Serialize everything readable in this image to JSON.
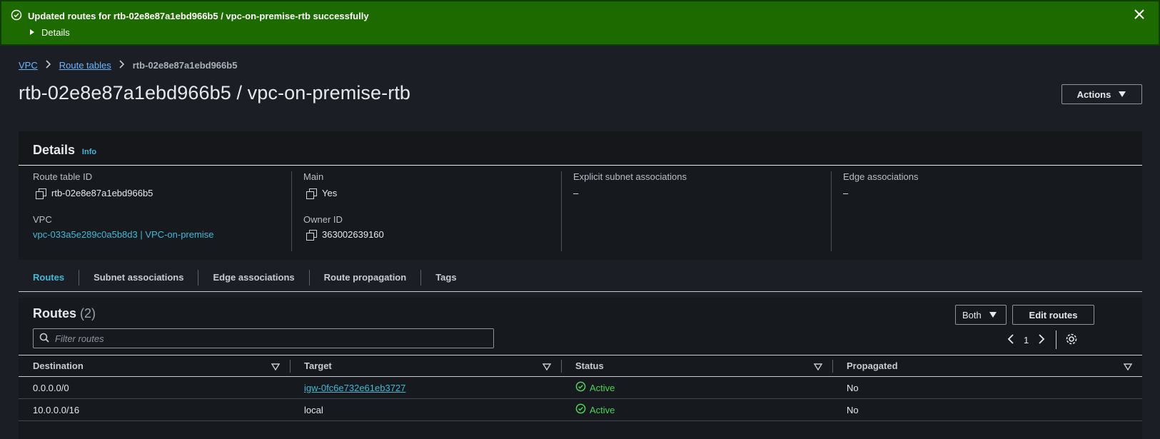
{
  "flash": {
    "message": "Updated routes for rtb-02e8e87a1ebd966b5 / vpc-on-premise-rtb successfully",
    "details_label": "Details"
  },
  "breadcrumb": {
    "items": [
      "VPC",
      "Route tables"
    ],
    "current": "rtb-02e8e87a1ebd966b5"
  },
  "page": {
    "title": "rtb-02e8e87a1ebd966b5 / vpc-on-premise-rtb",
    "actions_label": "Actions"
  },
  "details": {
    "heading": "Details",
    "info_label": "Info",
    "route_table_id_label": "Route table ID",
    "route_table_id": "rtb-02e8e87a1ebd966b5",
    "vpc_label": "VPC",
    "vpc_value": "vpc-033a5e289c0a5b8d3 | VPC-on-premise",
    "main_label": "Main",
    "main_value": "Yes",
    "owner_label": "Owner ID",
    "owner_value": "363002639160",
    "explicit_label": "Explicit subnet associations",
    "explicit_value": "–",
    "edge_label": "Edge associations",
    "edge_value": "–"
  },
  "tabs": [
    "Routes",
    "Subnet associations",
    "Edge associations",
    "Route propagation",
    "Tags"
  ],
  "routes": {
    "title": "Routes",
    "count": "(2)",
    "filter_select": "Both",
    "edit_label": "Edit routes",
    "filter_placeholder": "Filter routes",
    "page_number": "1",
    "columns": [
      "Destination",
      "Target",
      "Status",
      "Propagated"
    ],
    "rows": [
      {
        "destination": "0.0.0.0/0",
        "target": "igw-0fc6e732e61eb3727",
        "status": "Active",
        "propagated": "No"
      },
      {
        "destination": "10.0.0.0/16",
        "target": "local",
        "status": "Active",
        "propagated": "No"
      }
    ]
  },
  "colors": {
    "flash_bg": "#1d6b00",
    "link": "#44b9d6",
    "status_active": "#4fd35a"
  }
}
